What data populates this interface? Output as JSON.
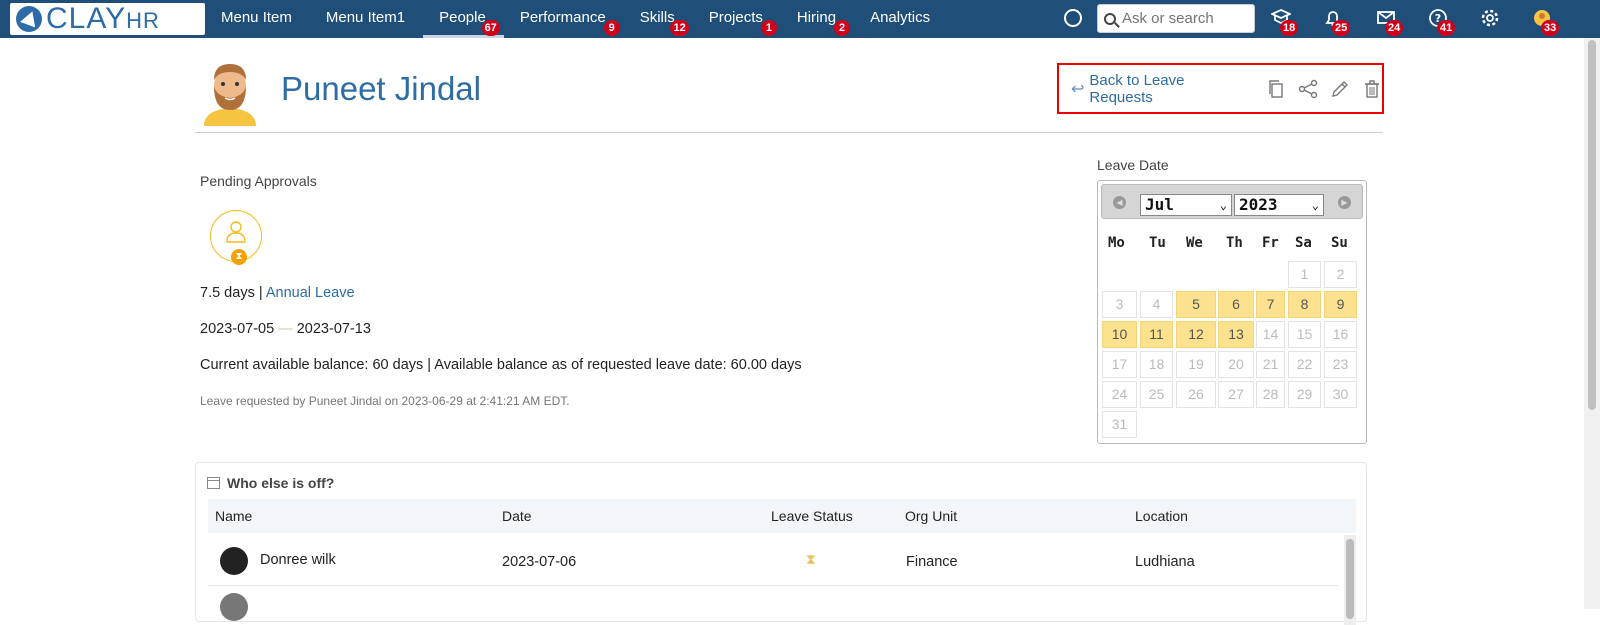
{
  "nav": {
    "logo": "CLAY",
    "logo_suffix": "HR",
    "items": [
      {
        "label": "Menu Item",
        "badge": ""
      },
      {
        "label": "Menu Item1",
        "badge": ""
      },
      {
        "label": "People",
        "badge": "67"
      },
      {
        "label": "Performance",
        "badge": "9"
      },
      {
        "label": "Skills",
        "badge": "12"
      },
      {
        "label": "Projects",
        "badge": "1"
      },
      {
        "label": "Hiring",
        "badge": "2"
      },
      {
        "label": "Analytics",
        "badge": ""
      }
    ],
    "search_placeholder": "Ask or search",
    "tools": [
      {
        "icon": "learning-icon",
        "badge": "18"
      },
      {
        "icon": "bell-icon",
        "badge": "25"
      },
      {
        "icon": "mail-icon",
        "badge": "24"
      },
      {
        "icon": "help-icon",
        "badge": "41"
      },
      {
        "icon": "gear-icon",
        "badge": ""
      },
      {
        "icon": "user-avatar-icon",
        "badge": "33"
      }
    ]
  },
  "header": {
    "name": "Puneet Jindal",
    "back_label": "Back to Leave Requests",
    "action_icons": [
      "copy-icon",
      "share-icon",
      "edit-icon",
      "trash-icon"
    ]
  },
  "request": {
    "section_label": "Pending Approvals",
    "days": "7.5 days |",
    "leave_type": "Annual Leave",
    "start": "2023-07-05",
    "dash": "—",
    "end": "2023-07-13",
    "balance": "Current available balance: 60 days | Available balance as of requested leave date: 60.00 days",
    "requested_by": "Leave requested by Puneet Jindal on 2023-06-29 at 2:41:21 AM EDT."
  },
  "calendar": {
    "label": "Leave Date",
    "month": "Jul",
    "year": "2023",
    "weekdays": [
      "Mo",
      "Tu",
      "We",
      "Th",
      "Fr",
      "Sa",
      "Su"
    ],
    "weeks": [
      [
        "",
        "",
        "",
        "",
        "",
        "1",
        "2"
      ],
      [
        "3",
        "4",
        "5",
        "6",
        "7",
        "8",
        "9"
      ],
      [
        "10",
        "11",
        "12",
        "13",
        "14",
        "15",
        "16"
      ],
      [
        "17",
        "18",
        "19",
        "20",
        "21",
        "22",
        "23"
      ],
      [
        "24",
        "25",
        "26",
        "27",
        "28",
        "29",
        "30"
      ],
      [
        "31",
        "",
        "",
        "",
        "",
        "",
        ""
      ]
    ],
    "highlighted": [
      "5",
      "6",
      "7",
      "8",
      "9",
      "10",
      "11",
      "12",
      "13"
    ]
  },
  "others": {
    "title": "Who else is off?",
    "columns": [
      "Name",
      "Date",
      "Leave Status",
      "Org Unit",
      "Location"
    ],
    "rows": [
      {
        "name": "Donree wilk",
        "date": "2023-07-06",
        "status_icon": "hourglass-icon",
        "org": "Finance",
        "location": "Ludhiana"
      }
    ]
  }
}
